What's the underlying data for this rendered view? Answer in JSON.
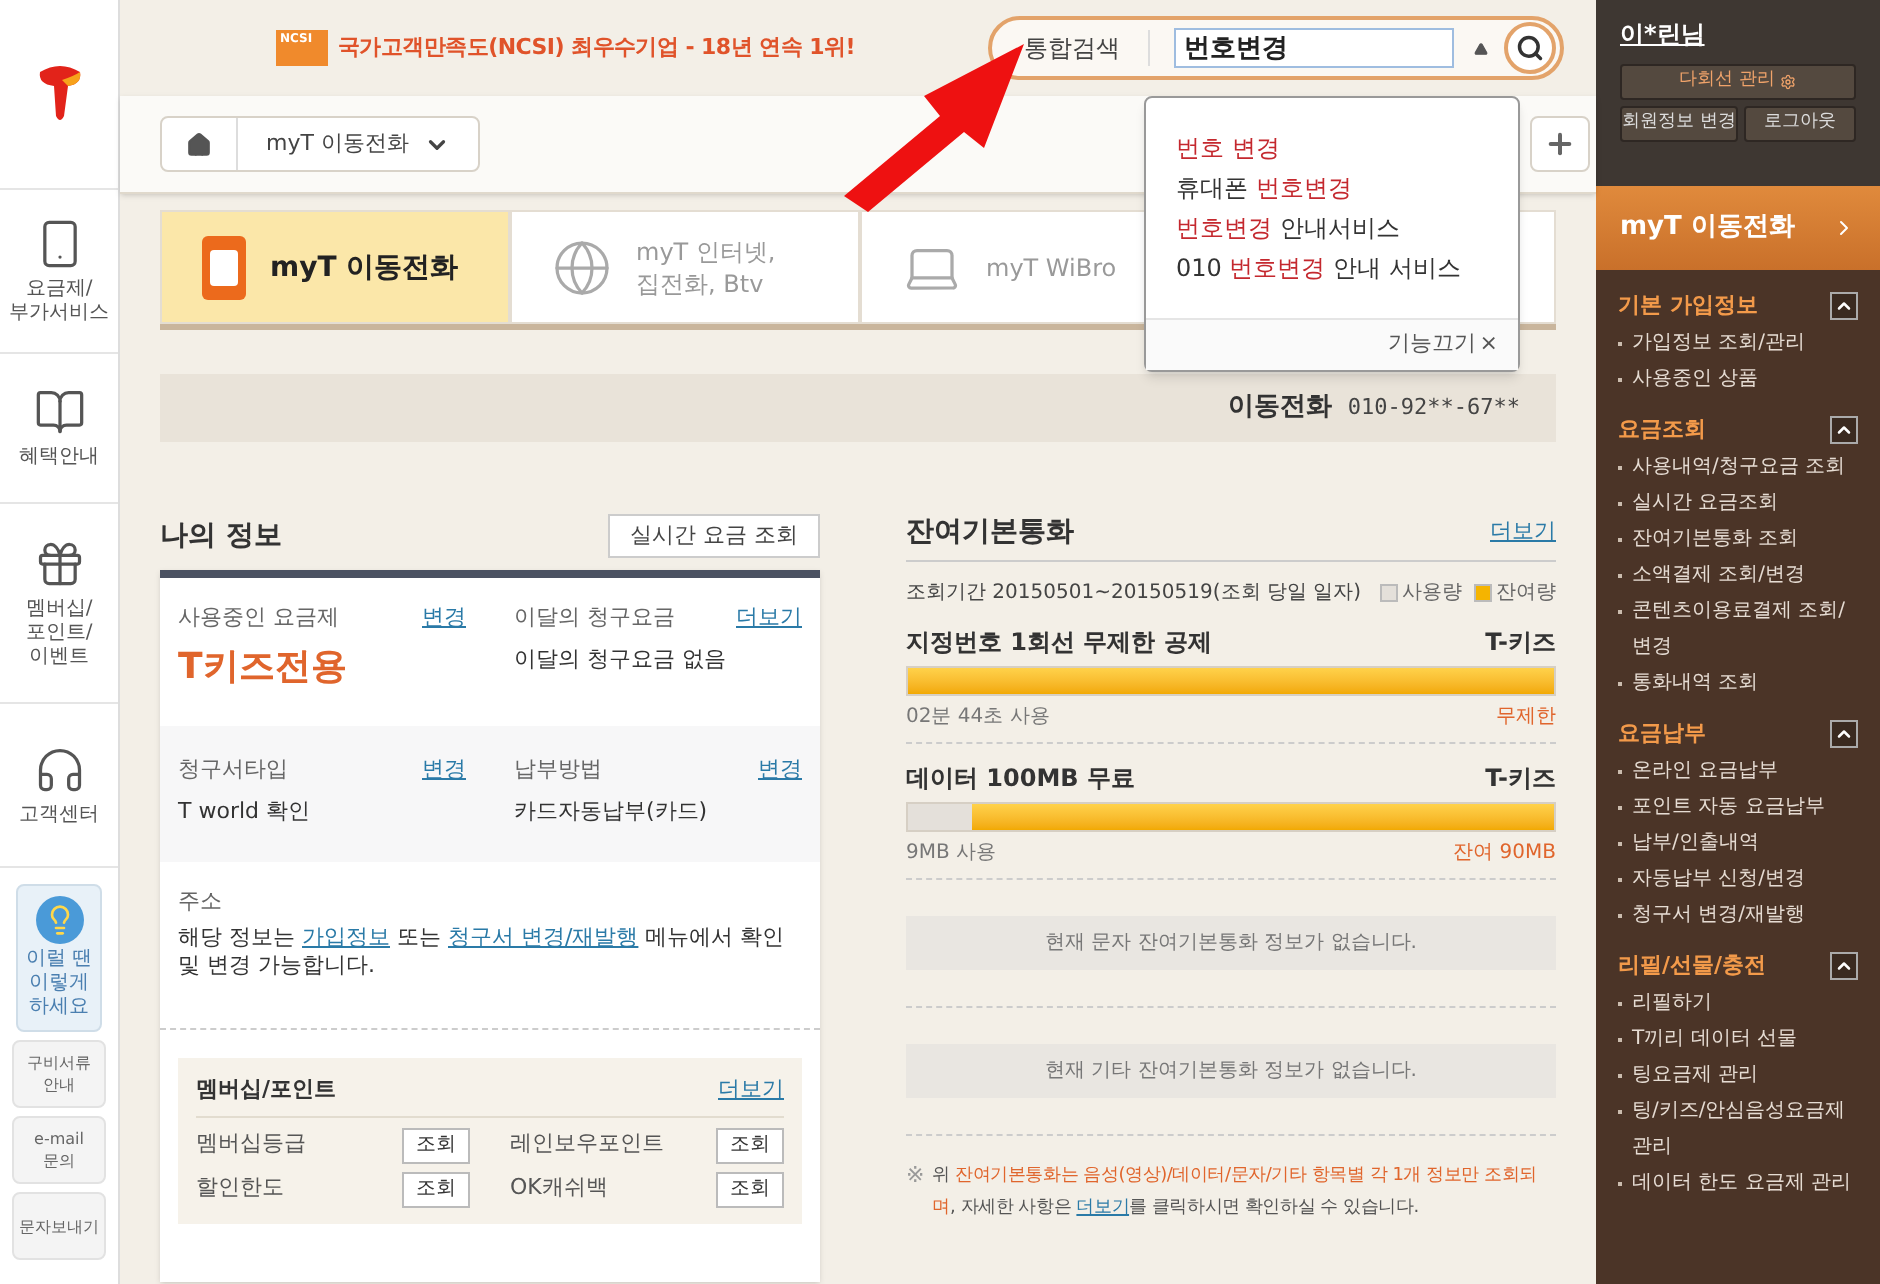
{
  "left_nav": {
    "items": [
      {
        "lines": [
          "요금제/",
          "부가서비스"
        ]
      },
      {
        "lines": [
          "혜택안내"
        ]
      },
      {
        "lines": [
          "멤버십/",
          "포인트/",
          "이벤트"
        ]
      },
      {
        "lines": [
          "고객센터"
        ]
      }
    ],
    "tip": {
      "lines": [
        "이럴 땐",
        "이렇게",
        "하세요"
      ]
    },
    "links": [
      {
        "lines": [
          "구비서류",
          "안내"
        ]
      },
      {
        "lines": [
          "e-mail",
          "문의"
        ]
      },
      {
        "lines": [
          "문자보내기"
        ]
      }
    ]
  },
  "banner": {
    "badge": "NCSI",
    "text": "국가고객만족도(NCSI) 최우수기업 - 18년 연속 1위!"
  },
  "search": {
    "category": "통합검색",
    "value": "번호변경",
    "suggestions": [
      [
        {
          "text": "번호 변경",
          "highlight": true
        }
      ],
      [
        {
          "text": "휴대폰 ",
          "highlight": false
        },
        {
          "text": "번호변경",
          "highlight": true
        }
      ],
      [
        {
          "text": "번호변경",
          "highlight": true
        },
        {
          "text": " 안내서비스",
          "highlight": false
        }
      ],
      [
        {
          "text": "010 ",
          "highlight": false
        },
        {
          "text": "번호변경",
          "highlight": true
        },
        {
          "text": " 안내 서비스",
          "highlight": false
        }
      ]
    ],
    "footer": "기능끄기",
    "close": "×"
  },
  "breadcrumb": {
    "label": "myT 이동전화"
  },
  "tabs": [
    {
      "lines": [
        "myT 이동전화"
      ],
      "selected": true
    },
    {
      "lines": [
        "myT 인터넷,",
        "집전화, Btv"
      ],
      "selected": false
    },
    {
      "lines": [
        "myT WiBro"
      ],
      "selected": false
    }
  ],
  "line_info": {
    "label": "이동전화",
    "number": "010-92**-67**"
  },
  "my_info": {
    "title": "나의 정보",
    "button": "실시간 요금 조회",
    "rows": [
      [
        {
          "label": "사용중인 요금제",
          "link": "변경",
          "value": "T키즈전용",
          "kind": "plan"
        },
        {
          "label": "이달의 청구요금",
          "link": "더보기",
          "value": "이달의 청구요금 없음",
          "kind": "text"
        }
      ],
      [
        {
          "label": "청구서타입",
          "link": "변경",
          "value": "T world 확인",
          "kind": "text"
        },
        {
          "label": "납부방법",
          "link": "변경",
          "value": "카드자동납부(카드)",
          "kind": "text"
        }
      ]
    ],
    "address": {
      "label": "주소",
      "parts": [
        {
          "text": "해당 정보는 ",
          "link": false
        },
        {
          "text": "가입정보",
          "link": true
        },
        {
          "text": " 또는 ",
          "link": false
        },
        {
          "text": "청구서 변경/재발행",
          "link": true
        },
        {
          "text": " 메뉴에서 확인 및 변경 가능합니다.",
          "link": false
        }
      ]
    },
    "membership": {
      "title": "멤버십/포인트",
      "more": "더보기",
      "items": [
        {
          "label": "멤버십등급",
          "button": "조회"
        },
        {
          "label": "레인보우포인트",
          "button": "조회"
        },
        {
          "label": "할인한도",
          "button": "조회"
        },
        {
          "label": "OK캐쉬백",
          "button": "조회"
        }
      ]
    }
  },
  "remaining": {
    "title": "잔여기본통화",
    "more": "더보기",
    "period": "조회기간 20150501~20150519(조회 당일 일자)",
    "legend": [
      {
        "label": "사용량",
        "color": "#e4e0da"
      },
      {
        "label": "잔여량",
        "color": "#f5b400"
      }
    ],
    "plans": [
      {
        "name": "지정번호 1회선 무제한 공제",
        "plan": "T-키즈",
        "level": 1,
        "used": "02분 44초 사용",
        "remaining": "무제한"
      },
      {
        "name": "데이터 100MB 무료",
        "plan": "T-키즈",
        "level": 0.9,
        "used": "9MB 사용",
        "remaining": "잔여 90MB"
      }
    ],
    "empty": [
      "현재 문자 잔여기본통화 정보가 없습니다.",
      "현재 기타 잔여기본통화 정보가 없습니다."
    ],
    "note": {
      "mark": "※",
      "parts": [
        {
          "text": "위 ",
          "kind": "plain"
        },
        {
          "text": "잔여기본통화는 음성(영상)/데이터/문자/기타 항목별 각 1개 정보만 조회되며",
          "kind": "accent"
        },
        {
          "text": ", 자세한 사항은 ",
          "kind": "plain"
        },
        {
          "text": "더보기",
          "kind": "link"
        },
        {
          "text": "를 클릭하시면 확인하실 수 있습니다.",
          "kind": "plain"
        }
      ]
    }
  },
  "sidebar": {
    "user": "이*린님",
    "multi_line": "다회선 관리",
    "buttons": [
      "회원정보 변경",
      "로그아웃"
    ],
    "current": "myT 이동전화",
    "sections": [
      {
        "title": "기본 가입정보",
        "expanded": true,
        "items": [
          "가입정보 조회/관리",
          "사용중인 상품"
        ]
      },
      {
        "title": "요금조회",
        "expanded": true,
        "items": [
          "사용내역/청구요금 조회",
          "실시간 요금조회",
          "잔여기본통화 조회",
          "소액결제 조회/변경",
          "콘텐츠이용료결제 조회/변경",
          "통화내역 조회"
        ]
      },
      {
        "title": "요금납부",
        "expanded": true,
        "items": [
          "온라인 요금납부",
          "포인트 자동 요금납부",
          "납부/인출내역",
          "자동납부 신청/변경",
          "청구서 변경/재발행"
        ]
      },
      {
        "title": "리필/선물/충전",
        "expanded": true,
        "items": [
          "리필하기",
          "T끼리 데이터 선물",
          "팅요금제 관리",
          "팅/키즈/안심음성요금제 관리",
          "데이터 한도 요금제 관리"
        ]
      }
    ]
  }
}
